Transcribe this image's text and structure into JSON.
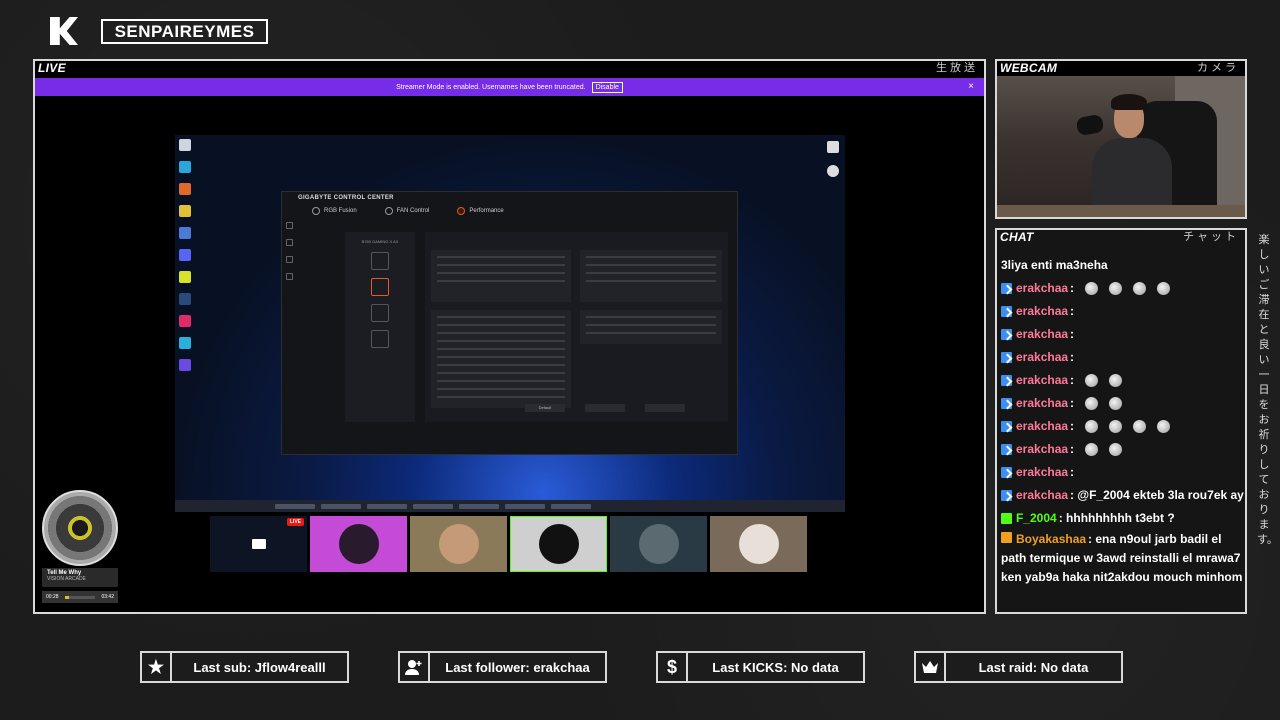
{
  "header": {
    "channel_name": "SENPAIREYMES"
  },
  "live_panel": {
    "label": "LIVE",
    "label_jp": "生放送",
    "streamer_mode_text": "Streamer Mode is enabled. Usernames have been truncated.",
    "disable_label": "Disable",
    "close_label": "×"
  },
  "gcc": {
    "title": "GIGABYTE CONTROL CENTER",
    "tabs": [
      "RGB Fusion",
      "FAN Control",
      "Performance"
    ],
    "sidebar_title": "B760 GAMING X AX",
    "buttons": [
      "Default"
    ]
  },
  "stream_thumbs": {
    "live_badge": "LIVE"
  },
  "now_playing": {
    "title": "Tell Me Why",
    "artist": "VISION ARCADE",
    "elapsed": "00:28",
    "duration": "03:42",
    "progress": 0.13
  },
  "webcam_panel": {
    "label": "WEBCAM",
    "label_jp": "カメラ"
  },
  "chat_panel": {
    "label": "CHAT",
    "label_jp": "チャット",
    "side_text_jp": "楽しいご滞在と良い一日をお祈りしております。",
    "messages": [
      {
        "user": "",
        "text": "3liya enti ma3neha",
        "badge": "none",
        "emotes": 0
      },
      {
        "user": "erakchaa",
        "text": ":",
        "badge": "kick",
        "emotes": 4
      },
      {
        "user": "erakchaa",
        "text": ":",
        "badge": "kick",
        "emotes": 0
      },
      {
        "user": "erakchaa",
        "text": ":",
        "badge": "kick",
        "emotes": 0
      },
      {
        "user": "erakchaa",
        "text": ":",
        "badge": "kick",
        "emotes": 0
      },
      {
        "user": "erakchaa",
        "text": ":",
        "badge": "kick",
        "emotes": 2
      },
      {
        "user": "erakchaa",
        "text": ":",
        "badge": "kick",
        "emotes": 2
      },
      {
        "user": "erakchaa",
        "text": ":",
        "badge": "kick",
        "emotes": 4
      },
      {
        "user": "erakchaa",
        "text": ":",
        "badge": "kick",
        "emotes": 2
      },
      {
        "user": "erakchaa",
        "text": ":",
        "badge": "kick",
        "emotes": 0
      },
      {
        "user": "erakchaa",
        "text": ": @F_2004 ekteb 3la rou7ek ay",
        "badge": "kick",
        "emotes": 0
      },
      {
        "user": "F_2004",
        "text": ": hhhhhhhhh t3ebt ?",
        "badge": "green",
        "emotes": 0
      },
      {
        "user": "Boyakashaa",
        "text": ": ena n9oul jarb badil el path termique w 3awd reinstalli el mrawa7 ken yab9a haka nit2akdou mouch minhom",
        "badge": "orange",
        "emotes": 0
      }
    ]
  },
  "alerts": {
    "last_sub": "Last sub: Jflow4realll",
    "last_follower": "Last follower: erakchaa",
    "last_kicks": "Last KICKS: No data",
    "last_raid": "Last raid: No data",
    "kicks_icon": "$"
  },
  "colors": {
    "accent_purple": "#772ce8",
    "user_pink": "#ff7a9a",
    "user_green": "#53fc18",
    "user_orange": "#f0a020",
    "live_red": "#e91916"
  }
}
